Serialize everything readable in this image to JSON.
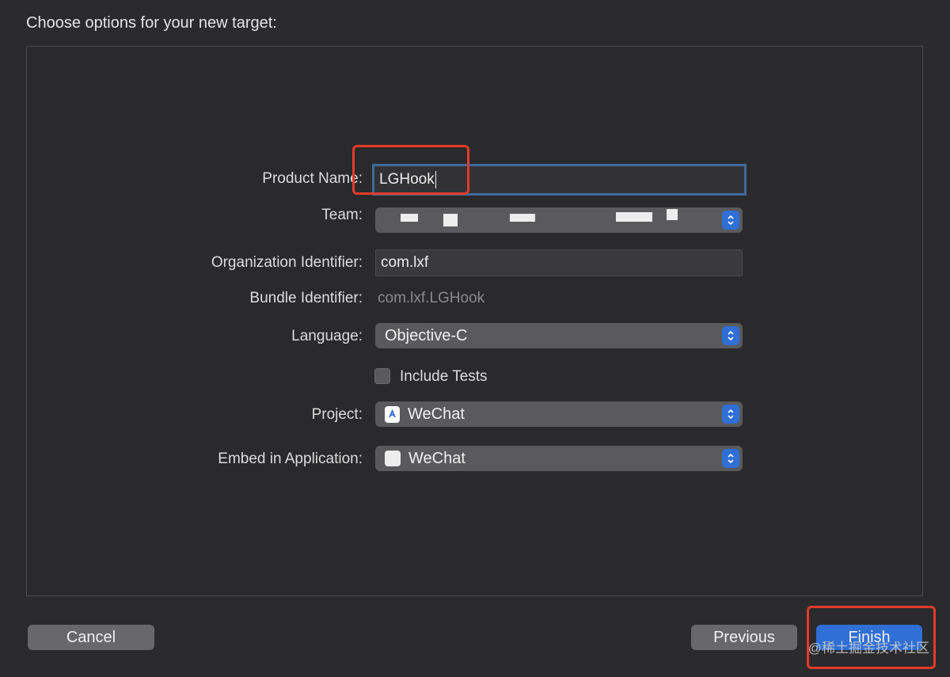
{
  "dialog": {
    "title": "Choose options for your new target:"
  },
  "form": {
    "product_name": {
      "label": "Product Name:",
      "value": "LGHook"
    },
    "team": {
      "label": "Team:",
      "value": ""
    },
    "organization_identifier": {
      "label": "Organization Identifier:",
      "value": "com.lxf"
    },
    "bundle_identifier": {
      "label": "Bundle Identifier:",
      "value": "com.lxf.LGHook"
    },
    "language": {
      "label": "Language:",
      "value": "Objective-C"
    },
    "include_tests": {
      "label": "Include Tests",
      "checked": false
    },
    "project": {
      "label": "Project:",
      "value": "WeChat",
      "icon": "xcode-project-icon"
    },
    "embed_in_application": {
      "label": "Embed in Application:",
      "value": "WeChat",
      "icon": "app-icon"
    }
  },
  "buttons": {
    "cancel": "Cancel",
    "previous": "Previous",
    "finish": "Finish"
  },
  "annotation_color": "#e23b2a",
  "accent_color": "#2f6fd6",
  "watermark": "@稀土掘金技术社区"
}
